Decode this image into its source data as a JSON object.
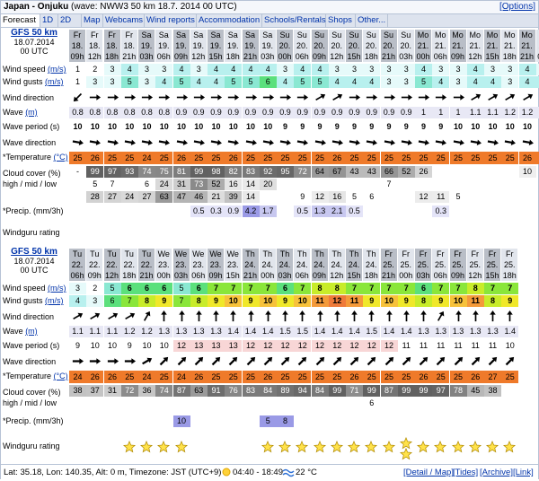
{
  "header": {
    "location": "Japan - Onjuku",
    "wave_info": "(wave: NWW3 50 km 18.7. 2014 00 UTC)",
    "options_label": "[Options]"
  },
  "tabs": [
    "Forecast",
    "1D",
    "2D",
    "Map",
    "Webcams",
    "Wind reports",
    "Accommodation",
    "Schools/Rentals",
    "Shops",
    "Other..."
  ],
  "row_labels": {
    "wind_speed": "Wind speed",
    "wind_gusts": "Wind gusts",
    "unit_ms": "(m/s)",
    "wind_direction": "Wind direction",
    "wave": "Wave",
    "unit_m": "(m)",
    "wave_period": "Wave period (s)",
    "wave_direction": "Wave direction",
    "temperature": "*Temperature",
    "unit_c": "(°C)",
    "cloud_cover_1": "Cloud cover (%)",
    "cloud_cover_2": "high / mid / low",
    "precip": "*Precip. (mm/3h)",
    "rating": "Windguru rating"
  },
  "colors": {
    "header_light": "#e1e5ec",
    "header_dark": "#b9bec7",
    "temp_orange": "#ef7a2a",
    "wave_bg": "#e8e8f5",
    "star": "#ffe24a",
    "link": "#0033aa"
  },
  "block1": {
    "model": "GFS 50 km",
    "date": "18.07.2014",
    "utc": "00 UTC",
    "days": [
      "Fr",
      "Fr",
      "Fr",
      "Fr",
      "Sa",
      "Sa",
      "Sa",
      "Sa",
      "Sa",
      "Sa",
      "Sa",
      "Sa",
      "Su",
      "Su",
      "Su",
      "Su",
      "Su",
      "Su",
      "Su",
      "Su",
      "Mo",
      "Mo",
      "Mo",
      "Mo",
      "Mo",
      "Mo",
      "Mo",
      "Mo"
    ],
    "dates": [
      "18.",
      "18.",
      "18.",
      "18.",
      "19.",
      "19.",
      "19.",
      "19.",
      "19.",
      "19.",
      "19.",
      "19.",
      "20.",
      "20.",
      "20.",
      "20.",
      "20.",
      "20.",
      "20.",
      "20.",
      "21.",
      "21.",
      "21.",
      "21.",
      "21.",
      "21.",
      "21.",
      "22."
    ],
    "hours": [
      "09h",
      "12h",
      "18h",
      "21h",
      "03h",
      "06h",
      "09h",
      "12h",
      "15h",
      "18h",
      "21h",
      "03h",
      "00h",
      "06h",
      "09h",
      "12h",
      "15h",
      "18h",
      "21h",
      "03h",
      "00h",
      "06h",
      "09h",
      "12h",
      "15h",
      "18h",
      "21h",
      "03h"
    ],
    "wind_speed": [
      "1",
      "2",
      "3",
      "4",
      "3",
      "3",
      "4",
      "3",
      "4",
      "4",
      "4",
      "4",
      "3",
      "4",
      "4",
      "3",
      "3",
      "3",
      "3",
      "3",
      "4",
      "3",
      "3",
      "4",
      "3",
      "3",
      "4",
      "3"
    ],
    "wind_gusts": [
      "1",
      "3",
      "3",
      "5",
      "3",
      "4",
      "5",
      "4",
      "4",
      "5",
      "5",
      "6",
      "4",
      "5",
      "5",
      "4",
      "4",
      "4",
      "3",
      "3",
      "5",
      "4",
      "3",
      "4",
      "4",
      "3",
      "4",
      "4"
    ],
    "wind_dir": [
      225,
      90,
      90,
      90,
      90,
      90,
      90,
      90,
      90,
      90,
      90,
      90,
      90,
      90,
      60,
      60,
      90,
      90,
      90,
      90,
      90,
      90,
      90,
      60,
      60,
      60,
      60,
      60
    ],
    "wave": [
      "0.8",
      "0.8",
      "0.8",
      "0.8",
      "0.8",
      "0.8",
      "0.9",
      "0.9",
      "0.9",
      "0.9",
      "0.9",
      "0.9",
      "0.9",
      "0.9",
      "0.9",
      "0.9",
      "0.9",
      "0.9",
      "0.9",
      "0.9",
      "1",
      "1",
      "1",
      "1.1",
      "1.1",
      "1.2",
      "1.2",
      "1.1"
    ],
    "wave_period": [
      "10",
      "10",
      "10",
      "10",
      "10",
      "10",
      "10",
      "10",
      "10",
      "10",
      "10",
      "10",
      "9",
      "9",
      "9",
      "9",
      "9",
      "9",
      "9",
      "9",
      "9",
      "9",
      "10",
      "10",
      "10",
      "10",
      "10",
      "9"
    ],
    "wave_dir": [
      100,
      100,
      100,
      100,
      100,
      100,
      100,
      100,
      100,
      100,
      100,
      100,
      100,
      100,
      100,
      100,
      100,
      100,
      100,
      100,
      100,
      100,
      100,
      100,
      100,
      100,
      100,
      100
    ],
    "temperature": [
      "25",
      "26",
      "25",
      "25",
      "24",
      "25",
      "26",
      "25",
      "25",
      "26",
      "25",
      "25",
      "25",
      "25",
      "25",
      "26",
      "25",
      "25",
      "25",
      "25",
      "25",
      "25",
      "25",
      "25",
      "25",
      "25",
      "26",
      "25"
    ],
    "cloud_high": [
      "-",
      "99",
      "97",
      "93",
      "74",
      "75",
      "81",
      "99",
      "98",
      "82",
      "83",
      "92",
      "95",
      "72",
      "64",
      "67",
      "43",
      "43",
      "66",
      "52",
      "26",
      "",
      "",
      "",
      "",
      "",
      "10",
      "5"
    ],
    "cloud_mid": [
      "",
      "5",
      "7",
      "",
      "6",
      "24",
      "31",
      "73",
      "52",
      "16",
      "14",
      "20",
      "",
      "",
      "",
      "",
      "",
      "",
      "7",
      "",
      "",
      "",
      "",
      "",
      "",
      "",
      "",
      ""
    ],
    "cloud_low": [
      "",
      "28",
      "27",
      "24",
      "27",
      "63",
      "47",
      "46",
      "21",
      "39",
      "14",
      "",
      "",
      "9",
      "12",
      "16",
      "5",
      "6",
      "",
      "",
      "12",
      "11",
      "5",
      "",
      "",
      "",
      "",
      ""
    ],
    "precip": [
      "",
      "",
      "",
      "",
      "",
      "",
      "",
      "0.5",
      "0.3",
      "0.9",
      "4.2",
      "1.7",
      "",
      "0.5",
      "1.3",
      "2.1",
      "0.5",
      "",
      "",
      "",
      "",
      "0.3",
      "",
      "",
      "",
      "",
      "",
      ""
    ],
    "stars": [
      0,
      0,
      0,
      0,
      0,
      0,
      0,
      0,
      0,
      0,
      0,
      0,
      0,
      0,
      0,
      0,
      0,
      0,
      0,
      0,
      0,
      0,
      0,
      0,
      0,
      0,
      0,
      0
    ]
  },
  "block2": {
    "model": "GFS 50 km",
    "date": "18.07.2014",
    "utc": "00 UTC",
    "days": [
      "Tu",
      "Tu",
      "Tu",
      "Tu",
      "Tu",
      "We",
      "We",
      "We",
      "We",
      "We",
      "Th",
      "Th",
      "Th",
      "Th",
      "Th",
      "Th",
      "Th",
      "Th",
      "Fr",
      "Fr",
      "Fr",
      "Fr",
      "Fr",
      "Fr",
      "Fr",
      "Fr"
    ],
    "dates": [
      "22.",
      "22.",
      "22.",
      "22.",
      "22.",
      "23.",
      "23.",
      "23.",
      "23.",
      "23.",
      "24.",
      "24.",
      "24.",
      "24.",
      "24.",
      "24.",
      "24.",
      "24.",
      "25.",
      "25.",
      "25.",
      "25.",
      "25.",
      "25.",
      "25.",
      "25."
    ],
    "hours": [
      "06h",
      "09h",
      "12h",
      "18h",
      "21h",
      "00h",
      "03h",
      "06h",
      "09h",
      "15h",
      "21h",
      "00h",
      "03h",
      "06h",
      "09h",
      "12h",
      "15h",
      "18h",
      "21h",
      "00h",
      "03h",
      "06h",
      "09h",
      "12h",
      "15h",
      "18h"
    ],
    "wind_speed": [
      "3",
      "2",
      "5",
      "6",
      "6",
      "6",
      "5",
      "6",
      "7",
      "7",
      "7",
      "7",
      "6",
      "7",
      "8",
      "8",
      "7",
      "7",
      "7",
      "7",
      "6",
      "7",
      "7",
      "8",
      "7",
      "7"
    ],
    "wind_gusts": [
      "4",
      "3",
      "6",
      "7",
      "8",
      "9",
      "7",
      "8",
      "9",
      "10",
      "9",
      "10",
      "9",
      "10",
      "11",
      "12",
      "11",
      "9",
      "10",
      "9",
      "8",
      "9",
      "10",
      "11",
      "8",
      "9"
    ],
    "wind_dir": [
      60,
      60,
      60,
      60,
      30,
      0,
      0,
      0,
      0,
      0,
      0,
      0,
      0,
      0,
      0,
      0,
      0,
      0,
      0,
      0,
      0,
      30,
      0,
      0,
      0,
      0
    ],
    "wave": [
      "1.1",
      "1.1",
      "1.1",
      "1.2",
      "1.2",
      "1.3",
      "1.3",
      "1.3",
      "1.3",
      "1.4",
      "1.4",
      "1.4",
      "1.5",
      "1.5",
      "1.4",
      "1.4",
      "1.4",
      "1.5",
      "1.4",
      "1.4",
      "1.3",
      "1.3",
      "1.3",
      "1.3",
      "1.3",
      "1.4"
    ],
    "wave_period": [
      "9",
      "10",
      "10",
      "9",
      "10",
      "10",
      "12",
      "13",
      "13",
      "13",
      "12",
      "12",
      "12",
      "12",
      "12",
      "12",
      "12",
      "12",
      "12",
      "11",
      "11",
      "11",
      "11",
      "11",
      "11",
      "10"
    ],
    "wave_dir": [
      90,
      90,
      90,
      90,
      60,
      45,
      45,
      45,
      45,
      45,
      45,
      45,
      45,
      45,
      45,
      45,
      45,
      45,
      45,
      45,
      45,
      45,
      45,
      45,
      45,
      45
    ],
    "temperature": [
      "24",
      "26",
      "26",
      "25",
      "24",
      "25",
      "24",
      "26",
      "25",
      "25",
      "25",
      "26",
      "25",
      "25",
      "25",
      "25",
      "26",
      "25",
      "25",
      "25",
      "26",
      "25",
      "25",
      "26",
      "27",
      "25"
    ],
    "cloud_high": [
      "38",
      "37",
      "31",
      "72",
      "36",
      "74",
      "87",
      "63",
      "91",
      "76",
      "83",
      "84",
      "89",
      "94",
      "84",
      "99",
      "71",
      "99",
      "87",
      "99",
      "99",
      "97",
      "78",
      "45",
      "38",
      ""
    ],
    "cloud_mid": [
      "",
      "",
      "",
      "",
      "",
      "",
      "",
      "",
      "",
      "",
      "",
      "",
      "",
      "",
      "",
      "",
      "",
      "6",
      "",
      "",
      "",
      "",
      "",
      "",
      "",
      ""
    ],
    "cloud_low": [
      "",
      "",
      "",
      "",
      "",
      "",
      "",
      "",
      "",
      "",
      "",
      "",
      "",
      "",
      "",
      "",
      "",
      "",
      "",
      "",
      "",
      "",
      "",
      "",
      "",
      ""
    ],
    "precip": [
      "",
      "",
      "",
      "",
      "",
      "",
      "10",
      "",
      "",
      "",
      "",
      "5",
      "8",
      "",
      "",
      "",
      "",
      "",
      "",
      "",
      "",
      "",
      "",
      "",
      "",
      ""
    ],
    "stars": [
      0,
      0,
      0,
      1,
      1,
      1,
      1,
      0,
      0,
      0,
      0,
      1,
      1,
      1,
      1,
      1,
      1,
      1,
      1,
      2,
      1,
      1,
      1,
      1,
      1,
      1
    ]
  },
  "footer": {
    "coords": "Lat: 35.18, Lon: 140.35, Alt: 0 m, Timezone: JST (UTC+9)",
    "sun": "04:40 - 18:49",
    "water_temp": "22 °C",
    "links": [
      "[Detail / Map]",
      "[Tides]",
      "[Archive]",
      "[Link]"
    ]
  }
}
